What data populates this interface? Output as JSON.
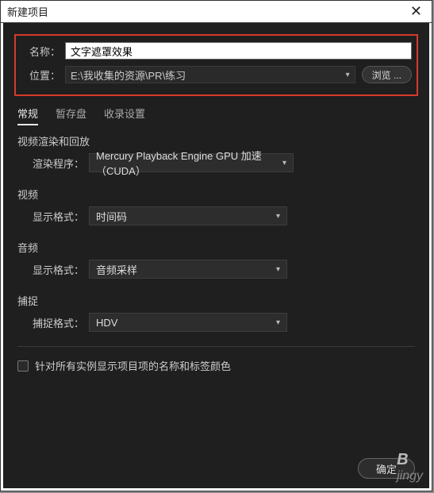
{
  "titlebar": {
    "title": "新建项目"
  },
  "form": {
    "name_label": "名称：",
    "name_value": "文字遮罩效果",
    "location_label": "位置：",
    "location_value": "E:\\我收集的资源\\PR\\练习",
    "browse_label": "浏览 ..."
  },
  "tabs": {
    "items": [
      {
        "label": "常规",
        "active": true
      },
      {
        "label": "暂存盘",
        "active": false
      },
      {
        "label": "收录设置",
        "active": false
      }
    ]
  },
  "sections": {
    "render": {
      "title": "视频渲染和回放",
      "renderer_label": "渲染程序：",
      "renderer_value": "Mercury Playback Engine GPU 加速（CUDA）"
    },
    "video": {
      "title": "视频",
      "format_label": "显示格式：",
      "format_value": "时间码"
    },
    "audio": {
      "title": "音频",
      "format_label": "显示格式：",
      "format_value": "音频采样"
    },
    "capture": {
      "title": "捕捉",
      "format_label": "捕捉格式：",
      "format_value": "HDV"
    }
  },
  "checkbox": {
    "label": "针对所有实例显示项目项的名称和标签颜色"
  },
  "footer": {
    "ok_label": "确定"
  },
  "watermark": {
    "brand": "B",
    "sub": "jingy"
  }
}
